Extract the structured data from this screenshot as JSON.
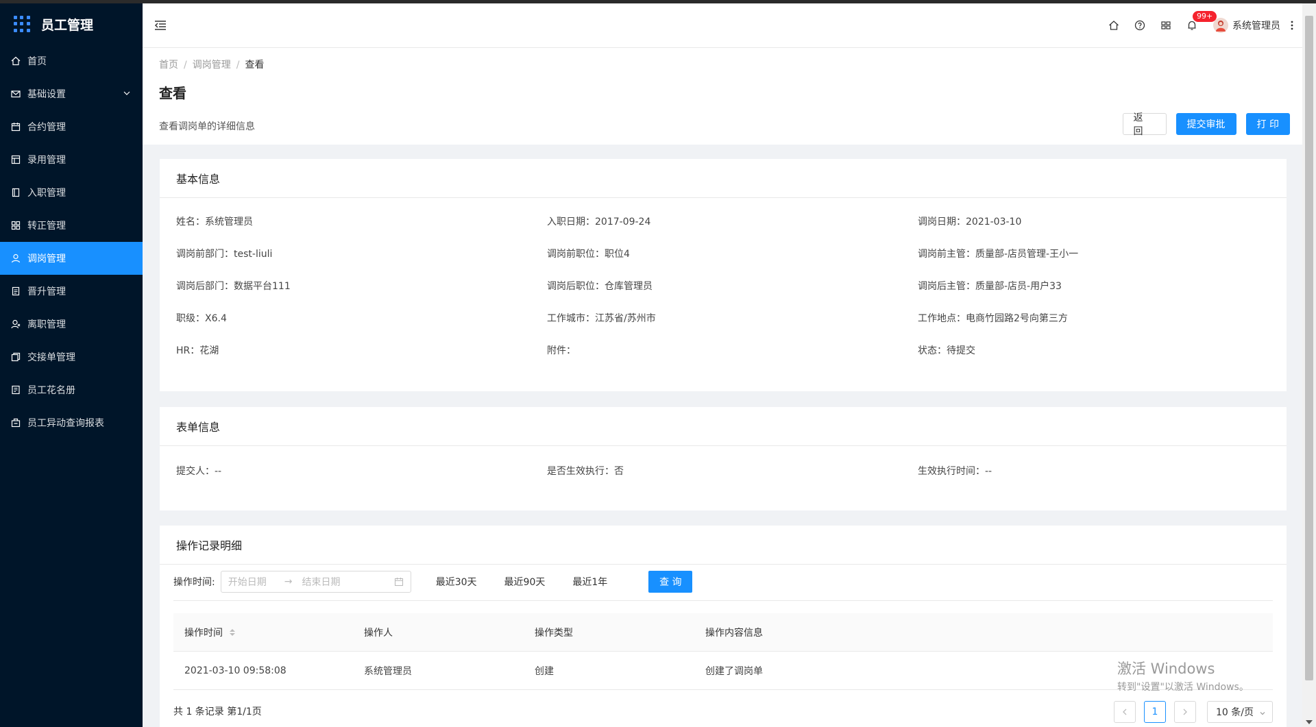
{
  "app": {
    "title": "员工管理"
  },
  "sidebar": {
    "items": [
      {
        "label": "首页",
        "icon": "home-icon",
        "active": false
      },
      {
        "label": "基础设置",
        "icon": "mail-icon",
        "active": false,
        "has_children": true
      },
      {
        "label": "合约管理",
        "icon": "calendar-icon",
        "active": false
      },
      {
        "label": "录用管理",
        "icon": "table-icon",
        "active": false
      },
      {
        "label": "入职管理",
        "icon": "book-icon",
        "active": false
      },
      {
        "label": "转正管理",
        "icon": "grid-icon",
        "active": false
      },
      {
        "label": "调岗管理",
        "icon": "user-icon",
        "active": true
      },
      {
        "label": "晋升管理",
        "icon": "file-icon",
        "active": false
      },
      {
        "label": "离职管理",
        "icon": "user-leave-icon",
        "active": false
      },
      {
        "label": "交接单管理",
        "icon": "copy-icon",
        "active": false
      },
      {
        "label": "员工花名册",
        "icon": "roster-icon",
        "active": false
      },
      {
        "label": "员工异动查询报表",
        "icon": "report-icon",
        "active": false
      }
    ]
  },
  "header": {
    "badge": "99+",
    "username": "系统管理员",
    "icons": [
      "home-icon",
      "help-icon",
      "apps-icon",
      "bell-icon",
      "more-icon"
    ]
  },
  "page": {
    "breadcrumb": [
      "首页",
      "调岗管理",
      "查看"
    ],
    "title": "查看",
    "description": "查看调岗单的详细信息",
    "buttons": {
      "back": "返 回",
      "submit": "提交审批",
      "print": "打 印"
    }
  },
  "basic_info": {
    "title": "基本信息",
    "fields": [
      {
        "label": "姓名：",
        "value": "系统管理员"
      },
      {
        "label": "入职日期：",
        "value": "2017-09-24"
      },
      {
        "label": "调岗日期：",
        "value": "2021-03-10"
      },
      {
        "label": "调岗前部门：",
        "value": "test-liuli"
      },
      {
        "label": "调岗前职位：",
        "value": "职位4"
      },
      {
        "label": "调岗前主管：",
        "value": "质量部-店员管理-王小一"
      },
      {
        "label": "调岗后部门：",
        "value": "数据平台111"
      },
      {
        "label": "调岗后职位：",
        "value": "仓库管理员"
      },
      {
        "label": "调岗后主管：",
        "value": "质量部-店员-用户33"
      },
      {
        "label": "职级：",
        "value": "X6.4"
      },
      {
        "label": "工作城市：",
        "value": "江苏省/苏州市"
      },
      {
        "label": "工作地点：",
        "value": "电商竹园路2号向第三方"
      },
      {
        "label": "HR：",
        "value": "花湖"
      },
      {
        "label": "附件：",
        "value": ""
      },
      {
        "label": "状态：",
        "value": "待提交"
      }
    ]
  },
  "form_info": {
    "title": "表单信息",
    "fields": [
      {
        "label": "提交人：",
        "value": "--"
      },
      {
        "label": "是否生效执行：",
        "value": "否"
      },
      {
        "label": "生效执行时间：",
        "value": "--"
      }
    ]
  },
  "operation_log": {
    "title": "操作记录明细",
    "filter": {
      "label": "操作时间:",
      "start_placeholder": "开始日期",
      "end_placeholder": "结束日期",
      "quick": [
        "最近30天",
        "最近90天",
        "最近1年"
      ],
      "query_button": "查 询"
    },
    "columns": [
      "操作时间",
      "操作人",
      "操作类型",
      "操作内容信息"
    ],
    "rows": [
      [
        "2021-03-10 09:58:08",
        "系统管理员",
        "创建",
        "创建了调岗单"
      ]
    ],
    "total_text": "共 1 条记录 第1/1页",
    "pagination": {
      "current": "1",
      "page_size": "10 条/页"
    }
  },
  "watermark": {
    "line1": "激活 Windows",
    "line2": "转到\"设置\"以激活 Windows。"
  }
}
